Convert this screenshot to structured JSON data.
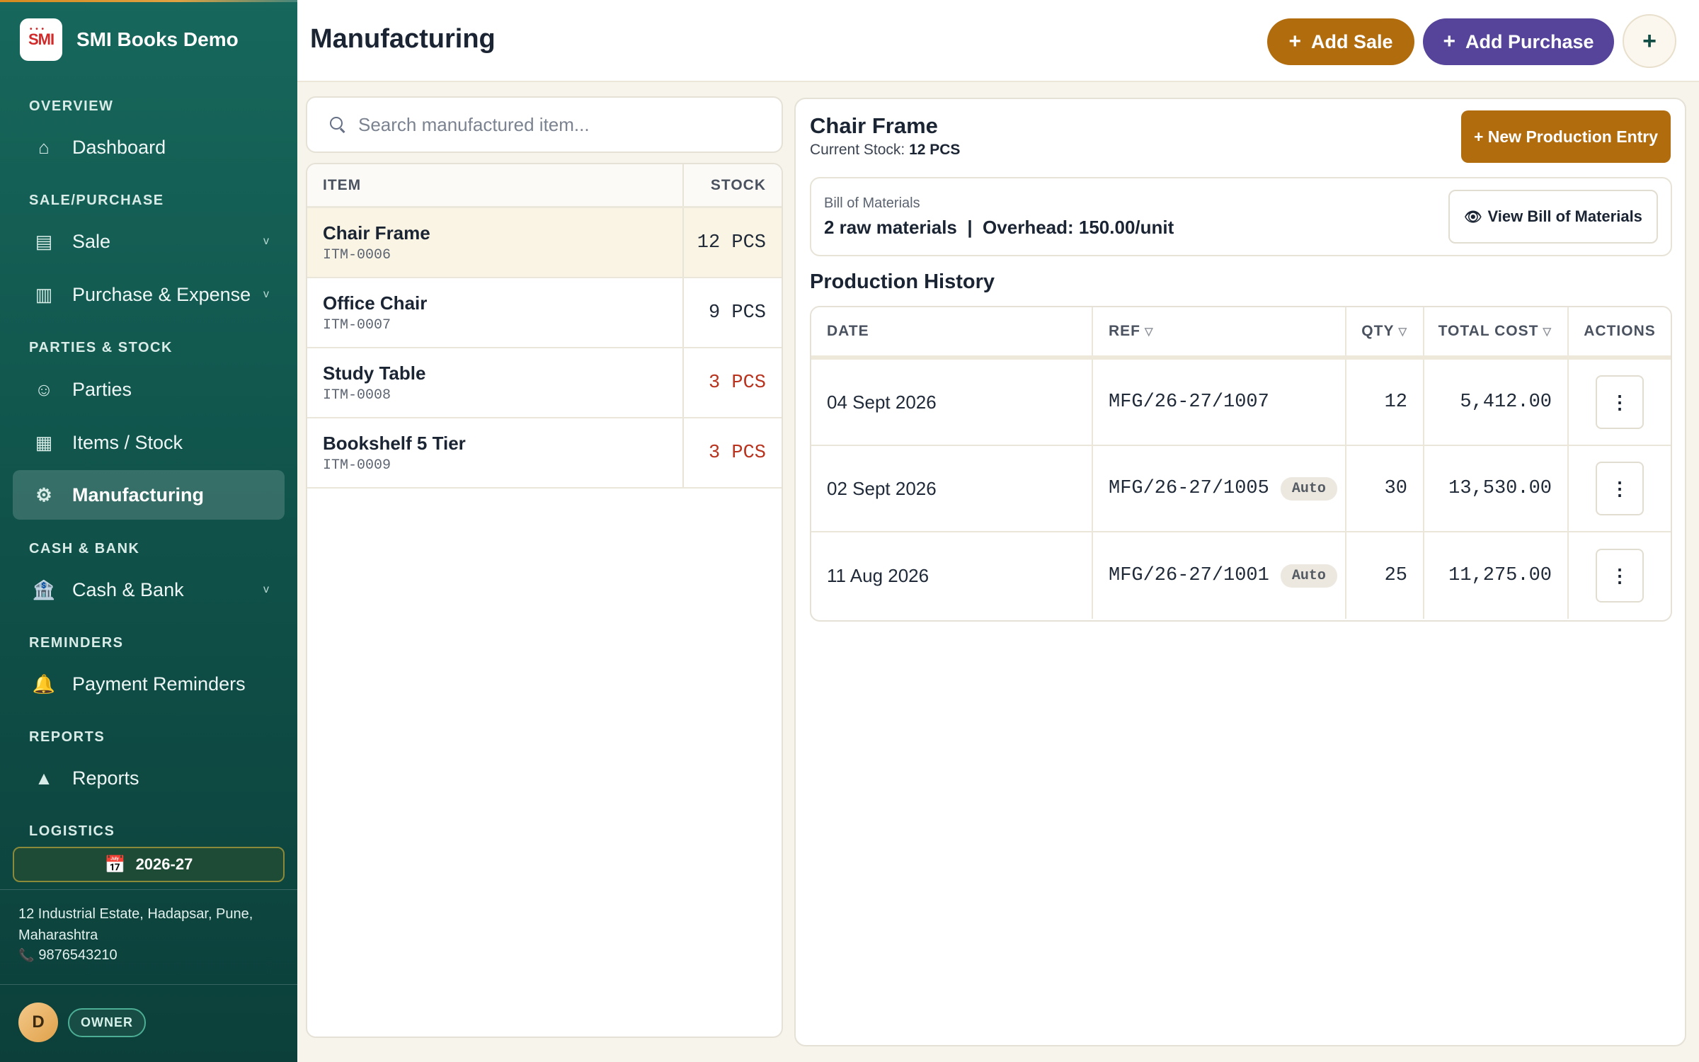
{
  "brand": {
    "name": "SMI Books Demo",
    "logo_text": "SMI"
  },
  "sidebar": {
    "sections": {
      "overview": "OVERVIEW",
      "sale_purchase": "SALE/PURCHASE",
      "parties_stock": "PARTIES & STOCK",
      "cash_bank": "CASH & BANK",
      "reminders": "REMINDERS",
      "reports": "REPORTS",
      "logistics": "LOGISTICS"
    },
    "items": {
      "dashboard": {
        "label": "Dashboard",
        "icon": "home-icon"
      },
      "sale": {
        "label": "Sale",
        "icon": "receipt-icon"
      },
      "purchase": {
        "label": "Purchase & Expense",
        "icon": "cart-icon"
      },
      "parties": {
        "label": "Parties",
        "icon": "smile-icon"
      },
      "items_stock": {
        "label": "Items / Stock",
        "icon": "grid-icon"
      },
      "manufacturing": {
        "label": "Manufacturing",
        "icon": "gear-icon",
        "active": true
      },
      "cash_bank": {
        "label": "Cash & Bank",
        "icon": "bank-icon"
      },
      "payment_reminders": {
        "label": "Payment Reminders",
        "icon": "bell-icon"
      },
      "reports": {
        "label": "Reports",
        "icon": "triangle-icon"
      }
    },
    "chevron": "v",
    "financial_year": "2026-27",
    "address": "12 Industrial Estate, Hadapsar, Pune, Maharashtra",
    "phone": "9876543210",
    "user": {
      "initial": "D",
      "role": "OWNER"
    }
  },
  "header": {
    "title": "Manufacturing",
    "add_sale_label": "Add Sale",
    "add_purchase_label": "Add Purchase",
    "plus_symbol": "+"
  },
  "colors": {
    "sidebar": "#0f5048",
    "accent_orange": "#b16c0e",
    "accent_purple": "#55449a",
    "low_stock": "#b8341f"
  },
  "search": {
    "placeholder": "Search manufactured item..."
  },
  "items_table": {
    "headers": {
      "item": "ITEM",
      "stock": "STOCK"
    },
    "rows": [
      {
        "name": "Chair Frame",
        "code": "ITM-0006",
        "stock": "12 PCS",
        "low": false,
        "selected": true
      },
      {
        "name": "Office Chair",
        "code": "ITM-0007",
        "stock": "9 PCS",
        "low": false,
        "selected": false
      },
      {
        "name": "Study Table",
        "code": "ITM-0008",
        "stock": "3 PCS",
        "low": true,
        "selected": false
      },
      {
        "name": "Bookshelf 5 Tier",
        "code": "ITM-0009",
        "stock": "3 PCS",
        "low": true,
        "selected": false
      }
    ]
  },
  "detail": {
    "title": "Chair Frame",
    "stock_label": "Current Stock:",
    "stock_value": "12 PCS",
    "new_production_label": "+ New Production Entry",
    "bom_label": "Bill of Materials",
    "bom_summary": "2 raw materials  |  Overhead: 150.00/unit",
    "view_bom_label": "View Bill of Materials",
    "history_title": "Production History",
    "history_headers": {
      "date": "DATE",
      "ref": "REF",
      "qty": "QTY",
      "total_cost": "TOTAL COST",
      "actions": "ACTIONS"
    },
    "history_rows": [
      {
        "date": "04 Sept 2026",
        "ref": "MFG/26-27/1007",
        "auto": "",
        "qty": "12",
        "total_cost": "5,412.00"
      },
      {
        "date": "02 Sept 2026",
        "ref": "MFG/26-27/1005",
        "auto": "Auto",
        "qty": "30",
        "total_cost": "13,530.00"
      },
      {
        "date": "11 Aug 2026",
        "ref": "MFG/26-27/1001",
        "auto": "Auto",
        "qty": "25",
        "total_cost": "11,275.00"
      }
    ]
  }
}
